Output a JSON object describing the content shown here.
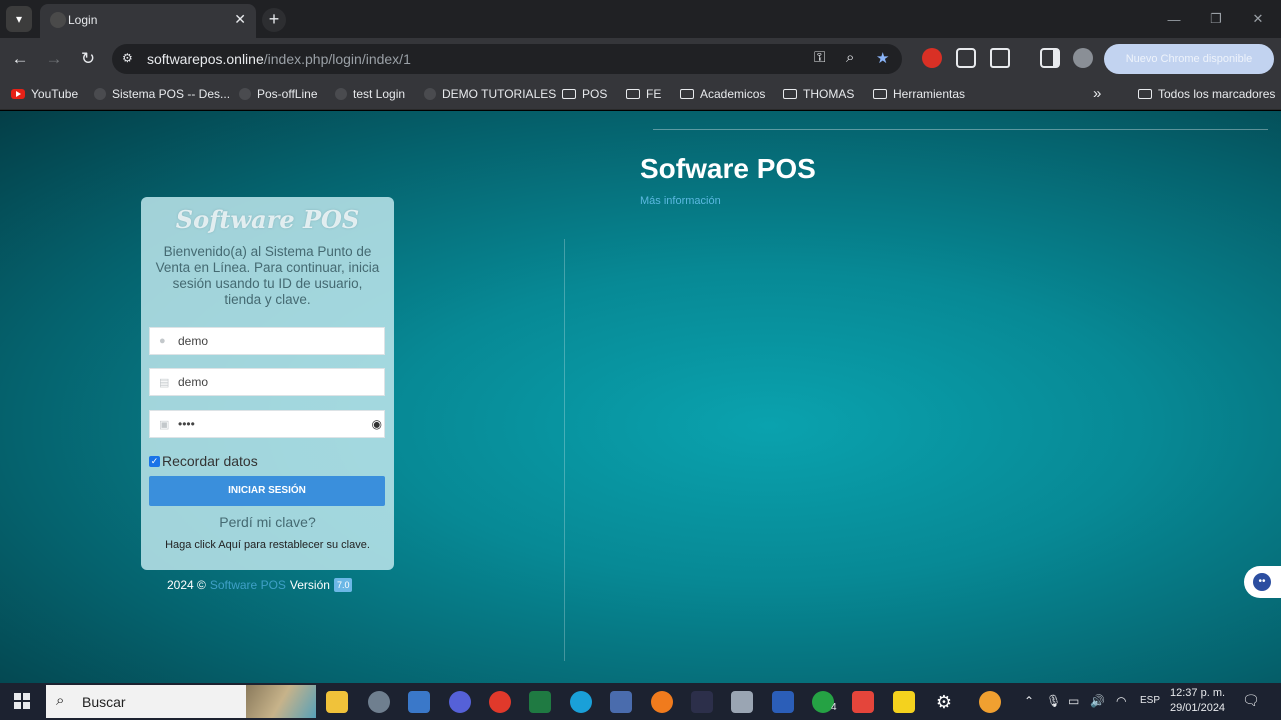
{
  "browser": {
    "tab_title": "Login",
    "url_host": "softwarepos.online",
    "url_path": "/index.php/login/index/1",
    "update_button": "Nuevo Chrome disponible"
  },
  "bookmarks": [
    {
      "label": "YouTube",
      "icon": "youtube-icon"
    },
    {
      "label": "Sistema POS -- Des...",
      "icon": "favicon"
    },
    {
      "label": "Pos-offLine",
      "icon": "favicon"
    },
    {
      "label": "test Login",
      "icon": "favicon"
    },
    {
      "label": "DEMO TUTORIALES",
      "icon": "favicon"
    },
    {
      "label": "POS",
      "icon": "folder-icon"
    },
    {
      "label": "FE",
      "icon": "folder-icon"
    },
    {
      "label": "Academicos",
      "icon": "folder-icon"
    },
    {
      "label": "THOMAS",
      "icon": "folder-icon"
    },
    {
      "label": "Herramientas",
      "icon": "folder-icon"
    },
    {
      "label": "Todos los marcadores",
      "icon": "folder-icon"
    }
  ],
  "page": {
    "brand_title": "Sofware POS",
    "more_info": "Más información",
    "card_logo": "Software POS",
    "intro": "Bienvenido(a) al Sistema Punto de Venta en Línea. Para continuar, inicia sesión usando tu ID de usuario, tienda y clave.",
    "user_value": "demo",
    "store_value": "demo",
    "password_value": "••••",
    "remember_label": "Recordar datos",
    "login_button": "INICIAR SESIÓN",
    "forgot": "Perdí mi clave?",
    "reset": "Haga click Aquí para restablecer su clave.",
    "footer_year": "2024 ©",
    "footer_brand": "Software POS",
    "footer_version_label": "Versión",
    "footer_version": "7.0"
  },
  "taskbar": {
    "search_placeholder": "Buscar",
    "language": "ESP",
    "time": "12:37 p. m.",
    "date": "29/01/2024",
    "whatsapp_badge": "4"
  },
  "colors": {
    "page_bg": "#078995",
    "login_button": "#3a8fdc",
    "card_bg": "#bee6ec"
  }
}
